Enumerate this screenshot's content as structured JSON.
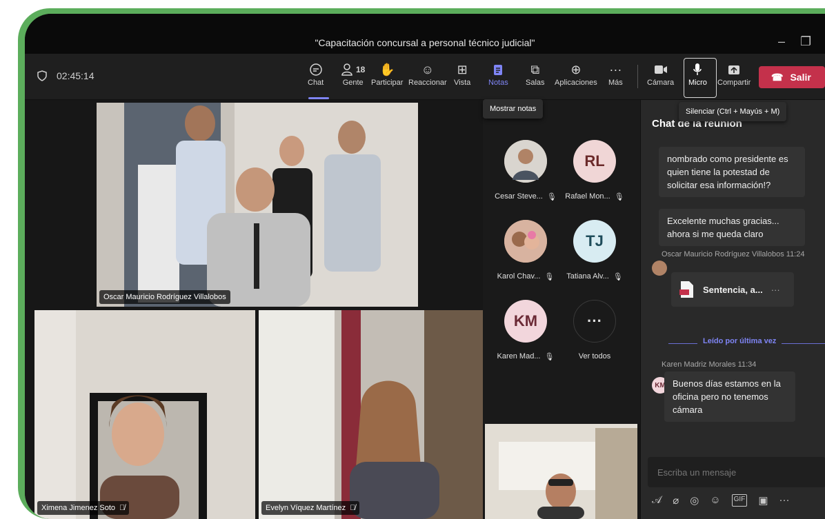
{
  "window": {
    "title": "\"Capacitación concursal a personal técnico judicial\""
  },
  "toolbar": {
    "timer": "02:45:14",
    "people_count": "18",
    "items": [
      {
        "label": "Chat",
        "icon": "chat-icon"
      },
      {
        "label": "Gente",
        "icon": "people-icon"
      },
      {
        "label": "Participar",
        "icon": "raise-hand-icon"
      },
      {
        "label": "Reaccionar",
        "icon": "smiley-icon"
      },
      {
        "label": "Vista",
        "icon": "grid-icon"
      },
      {
        "label": "Notas",
        "icon": "notes-icon"
      },
      {
        "label": "Salas",
        "icon": "rooms-icon"
      },
      {
        "label": "Aplicaciones",
        "icon": "apps-icon"
      },
      {
        "label": "Más",
        "icon": "more-icon"
      }
    ],
    "camera_label": "Cámara",
    "mic_label": "Micro",
    "share_label": "Compartir",
    "leave_label": "Salir"
  },
  "tooltips": {
    "notes": "Mostrar notas",
    "mic": "Silenciar (Ctrl + Mayús + M)"
  },
  "videos": {
    "main": "Oscar Mauricio Rodríguez Villalobos",
    "bottom_left": "Ximena Jimenez Soto",
    "bottom_mid": "Evelyn Víquez Martínez"
  },
  "roster": [
    {
      "name": "Cesar Steve...",
      "initials": "",
      "muted": true
    },
    {
      "name": "Rafael Mon...",
      "initials": "RL",
      "muted": true
    },
    {
      "name": "Karol Chav...",
      "initials": "",
      "muted": true
    },
    {
      "name": "Tatiana Alv...",
      "initials": "TJ",
      "muted": true
    },
    {
      "name": "Karen Mad...",
      "initials": "KM",
      "muted": true
    },
    {
      "name": "Ver todos",
      "initials": "···",
      "muted": false
    }
  ],
  "chat": {
    "title": "Chat de la reunión",
    "messages": [
      {
        "text": "nombrado como presidente es quien tiene la potestad de solicitar esa información!?"
      },
      {
        "text": "Excelente muchas gracias... ahora si me queda claro"
      }
    ],
    "oscar_meta": "Oscar Mauricio Rodríguez Villalobos  11:24",
    "attachment": "Sentencia, a...",
    "read_marker": "Leído por última vez",
    "karen_meta": "Karen Madriz Morales  11:34",
    "karen_initials": "KM",
    "karen_text": "Buenos días estamos en la oficina pero no tenemos cámara",
    "composer_placeholder": "Escriba un mensaje"
  },
  "colors": {
    "accent": "#7f85f5",
    "leave": "#c4314b",
    "frame": "#5cad5c"
  }
}
